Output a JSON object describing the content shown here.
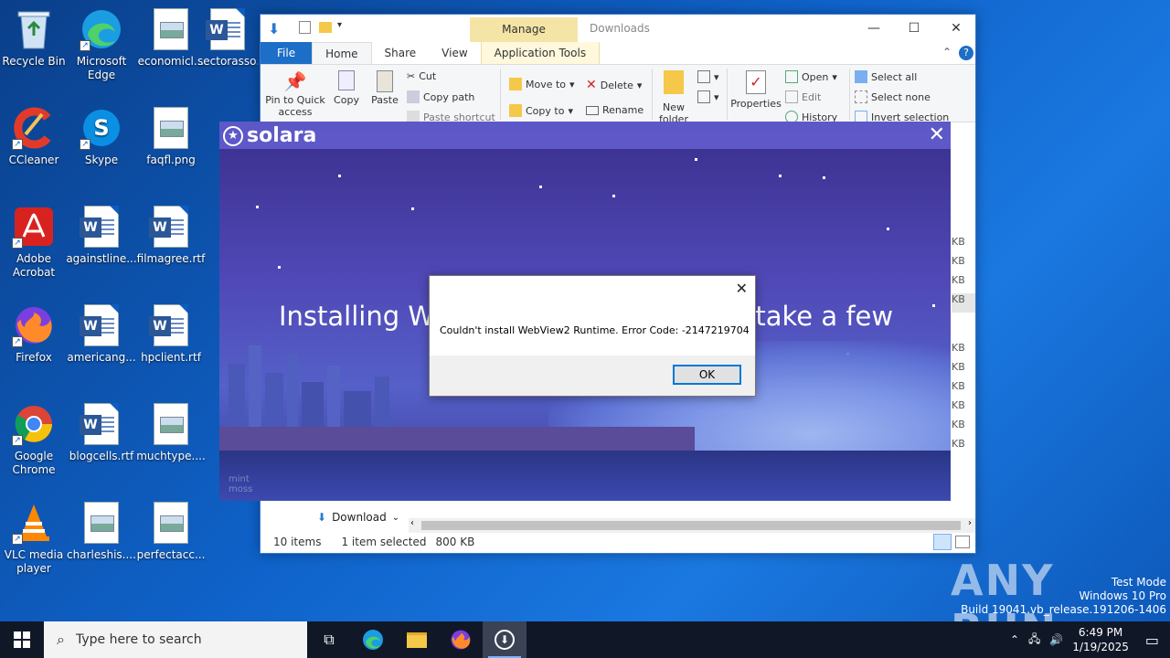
{
  "desktop": {
    "icons": [
      {
        "label": "Recycle Bin",
        "icon": "recycle-bin-icon"
      },
      {
        "label": "Microsoft Edge",
        "icon": "edge-icon"
      },
      {
        "label": "economicl...",
        "icon": "image-file-icon"
      },
      {
        "label": "sectorasso...",
        "icon": "word-file-icon"
      },
      {
        "label": "CCleaner",
        "icon": "ccleaner-icon"
      },
      {
        "label": "Skype",
        "icon": "skype-icon"
      },
      {
        "label": "faqfl.png",
        "icon": "image-file-icon"
      },
      {
        "label": "Adobe Acrobat",
        "icon": "acrobat-icon"
      },
      {
        "label": "againstline...",
        "icon": "word-file-icon"
      },
      {
        "label": "filmagree.rtf",
        "icon": "word-file-icon"
      },
      {
        "label": "Firefox",
        "icon": "firefox-icon"
      },
      {
        "label": "americang...",
        "icon": "word-file-icon"
      },
      {
        "label": "hpclient.rtf",
        "icon": "word-file-icon"
      },
      {
        "label": "Google Chrome",
        "icon": "chrome-icon"
      },
      {
        "label": "blogcells.rtf",
        "icon": "word-file-icon"
      },
      {
        "label": "muchtype....",
        "icon": "image-file-icon"
      },
      {
        "label": "VLC media player",
        "icon": "vlc-icon"
      },
      {
        "label": "charleshis....",
        "icon": "image-file-icon"
      },
      {
        "label": "perfectacc...",
        "icon": "image-file-icon"
      }
    ]
  },
  "explorer": {
    "title": "Downloads",
    "manage_tab": "Manage",
    "tabs": {
      "file": "File",
      "home": "Home",
      "share": "Share",
      "view": "View",
      "app_tools": "Application Tools"
    },
    "ribbon": {
      "pin": "Pin to Quick access",
      "copy": "Copy",
      "paste": "Paste",
      "cut": "Cut",
      "copy_path": "Copy path",
      "paste_shortcut": "Paste shortcut",
      "move_to": "Move to",
      "copy_to": "Copy to",
      "delete": "Delete",
      "rename": "Rename",
      "new_folder": "New folder",
      "properties": "Properties",
      "open": "Open",
      "edit": "Edit",
      "history": "History",
      "select_all": "Select all",
      "select_none": "Select none",
      "invert_selection": "Invert selection"
    },
    "nav_item": "Download",
    "size_col": [
      "KB",
      "KB",
      "KB",
      "KB",
      "KB",
      "KB",
      "KB",
      "KB",
      "KB",
      "KB"
    ],
    "status": {
      "items": "10 items",
      "selected": "1 item selected",
      "size": "800 KB"
    }
  },
  "solara": {
    "brand": "solara",
    "message_left": "Installing We",
    "message_right": "y take a few",
    "art_signature": "mint moss"
  },
  "dialog": {
    "message": "Couldn't install WebView2 Runtime. Error Code: -2147219704",
    "ok": "OK"
  },
  "watermark": {
    "brand": "ANY RUN",
    "mode": "Test Mode",
    "os": "Windows 10 Pro",
    "build": "Build 19041.vb_release.191206-1406"
  },
  "taskbar": {
    "search_placeholder": "Type here to search",
    "time": "6:49 PM",
    "date": "1/19/2025"
  }
}
